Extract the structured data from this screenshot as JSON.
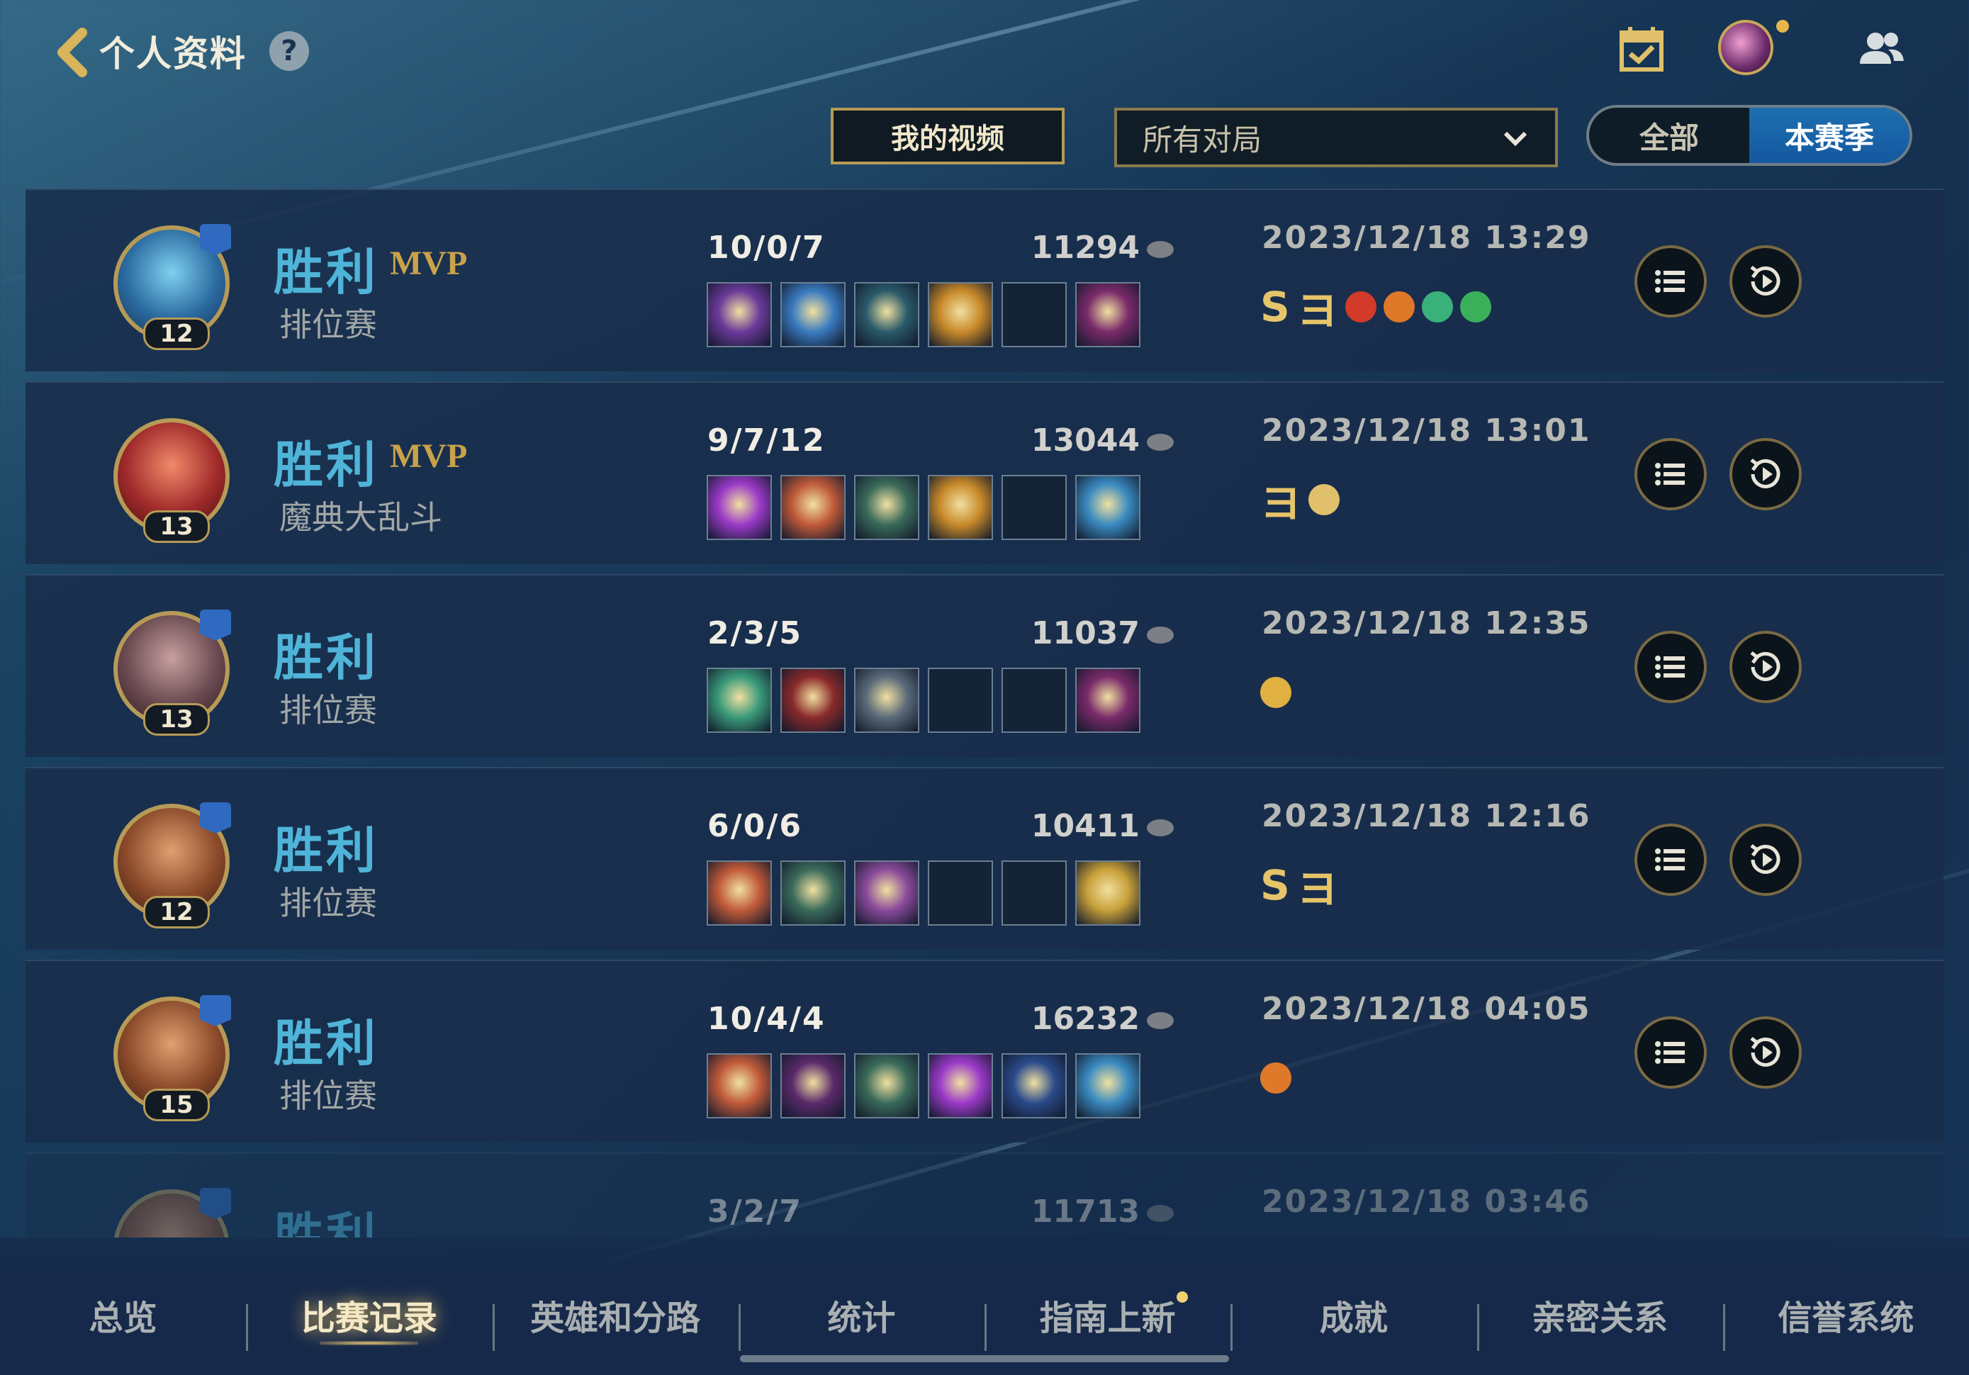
{
  "header": {
    "title": "个人资料",
    "help_symbol": "?",
    "icons": [
      "back-chevron-icon",
      "help-icon",
      "calendar-check-icon",
      "profile-avatar",
      "friends-icon"
    ]
  },
  "filters": {
    "my_videos_label": "我的视频",
    "match_type_selected": "所有对局",
    "season_options": [
      "全部",
      "本赛季"
    ],
    "season_active": "本赛季"
  },
  "matches": [
    {
      "result": "胜利",
      "mvp": "MVP",
      "mode": "排位赛",
      "level": "12",
      "party": true,
      "kda": "10/0/7",
      "gold": "11294",
      "timestamp": "2023/12/18 13:29",
      "items": [
        "#6b3a9a",
        "#3a7ac0",
        "#2a5a6a",
        "#c88a2a",
        "",
        "#7a2a6a"
      ],
      "badges": [
        "S",
        "ヨ",
        "red-wings",
        "orange-crest",
        "green-shield",
        "green-heart"
      ]
    },
    {
      "result": "胜利",
      "mvp": "MVP",
      "mode": "魔典大乱斗",
      "level": "13",
      "party": false,
      "kda": "9/7/12",
      "gold": "13044",
      "timestamp": "2023/12/18 13:01",
      "items": [
        "#9a3ac8",
        "#c05a3a",
        "#3a6a5a",
        "#c88a2a",
        "",
        "#3a8ac0"
      ],
      "badges": [
        "ヨ",
        "clock-swirl"
      ]
    },
    {
      "result": "胜利",
      "mvp": "",
      "mode": "排位赛",
      "level": "13",
      "party": true,
      "kda": "2/3/5",
      "gold": "11037",
      "timestamp": "2023/12/18 12:35",
      "items": [
        "#3a9a7a",
        "#8a2a2a",
        "#5a6a7a",
        "",
        "",
        "#7a2a6a"
      ],
      "badges": [
        "gold-fist"
      ]
    },
    {
      "result": "胜利",
      "mvp": "",
      "mode": "排位赛",
      "level": "12",
      "party": true,
      "kda": "6/0/6",
      "gold": "10411",
      "timestamp": "2023/12/18 12:16",
      "items": [
        "#c05a3a",
        "#3a6a5a",
        "#8a4a9a",
        "",
        "",
        "#c8a03a"
      ],
      "badges": [
        "S",
        "ヨ"
      ]
    },
    {
      "result": "胜利",
      "mvp": "",
      "mode": "排位赛",
      "level": "15",
      "party": true,
      "kda": "10/4/4",
      "gold": "16232",
      "timestamp": "2023/12/18 04:05",
      "items": [
        "#c05a3a",
        "#5a2a6a",
        "#3a6a5a",
        "#9a3ac8",
        "#2a4a8a",
        "#3a8ac0"
      ],
      "badges": [
        "orange-crest"
      ]
    },
    {
      "result": "胜利",
      "mvp": "",
      "mode": "",
      "level": "",
      "party": true,
      "kda": "3/2/7",
      "gold": "11713",
      "timestamp": "2023/12/18 03:46",
      "items": [],
      "badges": []
    }
  ],
  "bottom_nav": {
    "items": [
      "总览",
      "比赛记录",
      "英雄和分路",
      "统计",
      "指南上新",
      "成就",
      "亲密关系",
      "信誉系统"
    ],
    "active": "比赛记录",
    "dot_on": "指南上新"
  },
  "colors": {
    "win_text": "#4fb4d8",
    "mvp_gold": "#c9a24a",
    "accent_blue": "#1d6fb0"
  }
}
